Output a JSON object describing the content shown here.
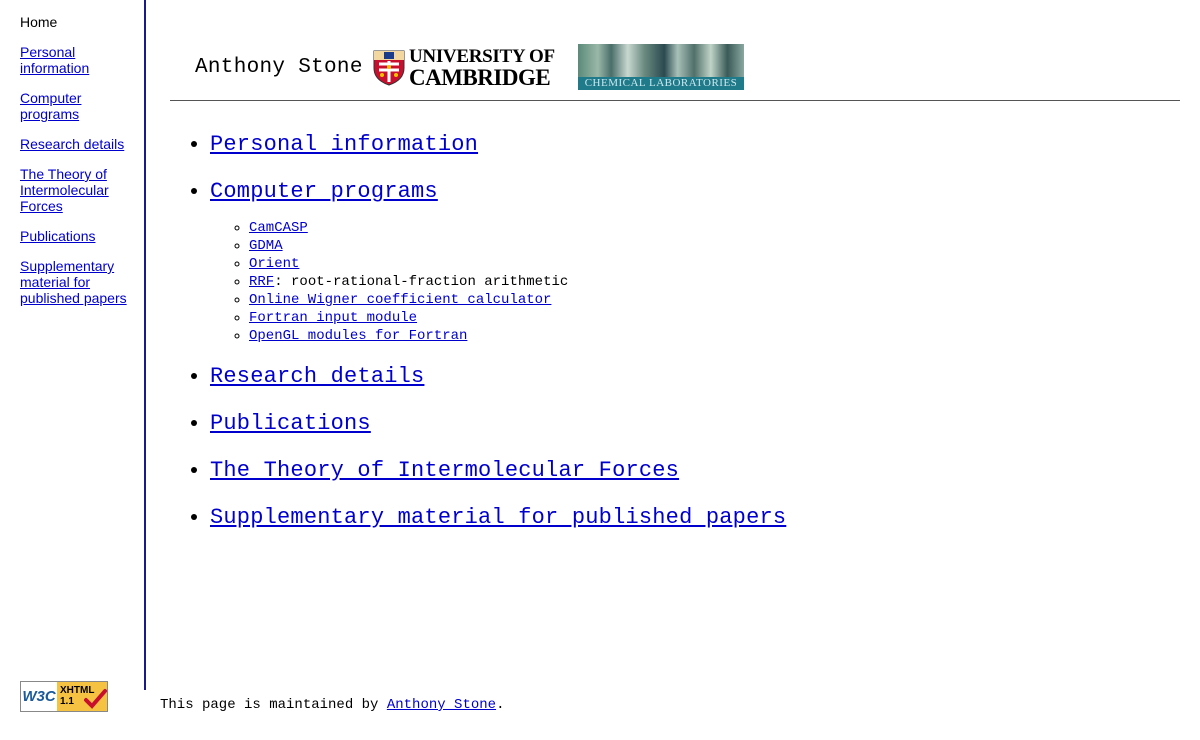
{
  "sidebar": {
    "items": [
      {
        "label": "Home",
        "link": false
      },
      {
        "label": "Personal information",
        "link": true
      },
      {
        "label": "Computer programs",
        "link": true
      },
      {
        "label": "Research details",
        "link": true
      },
      {
        "label": "The Theory of Intermolecular Forces",
        "link": true
      },
      {
        "label": "Publications",
        "link": true
      },
      {
        "label": "Supplementary material for published papers",
        "link": true
      }
    ]
  },
  "header": {
    "author": "Anthony Stone",
    "university_line1": "UNIVERSITY OF",
    "university_line2": "CAMBRIDGE",
    "banner_text": "CHEMICAL LABORATORIES",
    "crest_icon": "cambridge-crest-icon"
  },
  "main": {
    "items": [
      {
        "label": "Personal information"
      },
      {
        "label": "Computer programs",
        "children": [
          {
            "label": "CamCASP"
          },
          {
            "label": "GDMA"
          },
          {
            "label": "Orient"
          },
          {
            "label": "RRF",
            "suffix": ": root-rational-fraction arithmetic"
          },
          {
            "label": "Online Wigner coefficient calculator"
          },
          {
            "label": "Fortran input module"
          },
          {
            "label": "OpenGL modules for Fortran"
          }
        ]
      },
      {
        "label": "Research details"
      },
      {
        "label": "Publications"
      },
      {
        "label": "The Theory of Intermolecular Forces"
      },
      {
        "label": "Supplementary material for published papers"
      }
    ]
  },
  "footer": {
    "badge_left": "W3C",
    "badge_right_line1": "XHTML",
    "badge_right_line2": "1.1",
    "text_prefix": "This page is maintained by ",
    "maintainer": "Anthony Stone",
    "text_suffix": "."
  },
  "colors": {
    "link": "#0000cc",
    "sidebar_rule": "#1a1a8c",
    "badge_yellow": "#f5c242",
    "banner_teal": "#1f7a8a"
  }
}
